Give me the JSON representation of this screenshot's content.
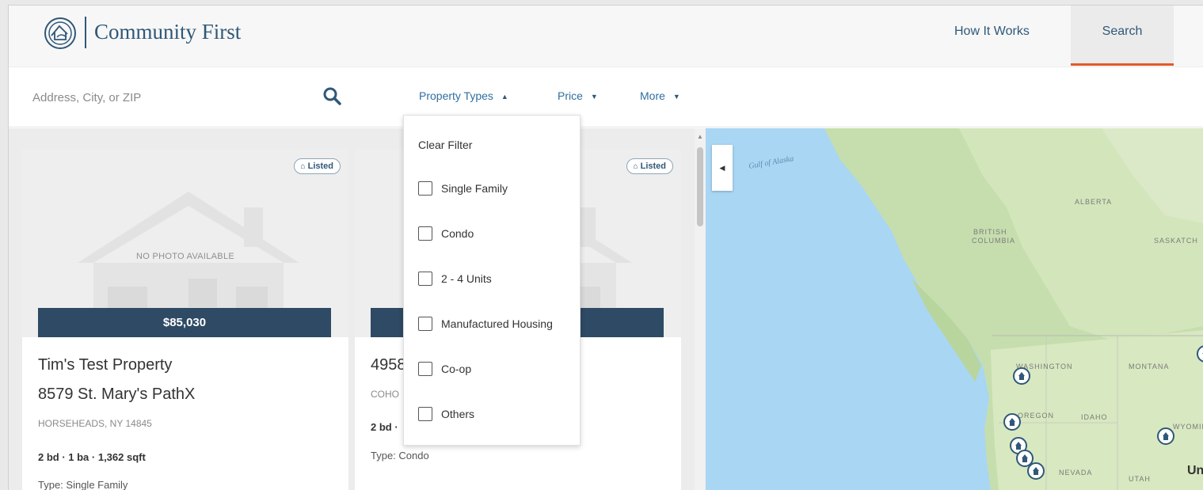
{
  "header": {
    "brand": "Community First",
    "nav": {
      "how_it_works": "How It Works",
      "search": "Search"
    }
  },
  "filters": {
    "search_placeholder": "Address, City, or ZIP",
    "property_types": "Property Types",
    "price": "Price",
    "more": "More"
  },
  "property_types_dropdown": {
    "clear": "Clear Filter",
    "options": [
      "Single Family",
      "Condo",
      "2 - 4 Units",
      "Manufactured Housing",
      "Co-op",
      "Others"
    ]
  },
  "listings": [
    {
      "badge": "Listed",
      "no_photo": "NO PHOTO AVAILABLE",
      "price": "$85,030",
      "title": "Tim's Test Property",
      "address": "8579 St. Mary's PathX",
      "city": "HORSEHEADS, NY 14845",
      "details": "2 bd · 1 ba · 1,362 sqft",
      "type": "Type: Single Family"
    },
    {
      "badge": "Listed",
      "title": "4958",
      "city": "COHO",
      "details": "2 bd ·",
      "type": "Type: Condo"
    }
  ],
  "map": {
    "labels": {
      "gulf": "Gulf of Alaska",
      "alberta": "ALBERTA",
      "bc1": "BRITISH",
      "bc2": "COLUMBIA",
      "sask": "SASKATCH",
      "washington": "WASHINGTON",
      "montana": "MONTANA",
      "oregon": "OREGON",
      "idaho": "IDAHO",
      "wyoming": "WYOMING",
      "nevada": "NEVADA",
      "utah": "UTAH",
      "us": "Un"
    }
  },
  "colors": {
    "brand": "#2f5878",
    "accent": "#e25a28",
    "price_bar": "#2e4a64",
    "water": "#a9d6f3",
    "land": "#c8dfb0"
  }
}
